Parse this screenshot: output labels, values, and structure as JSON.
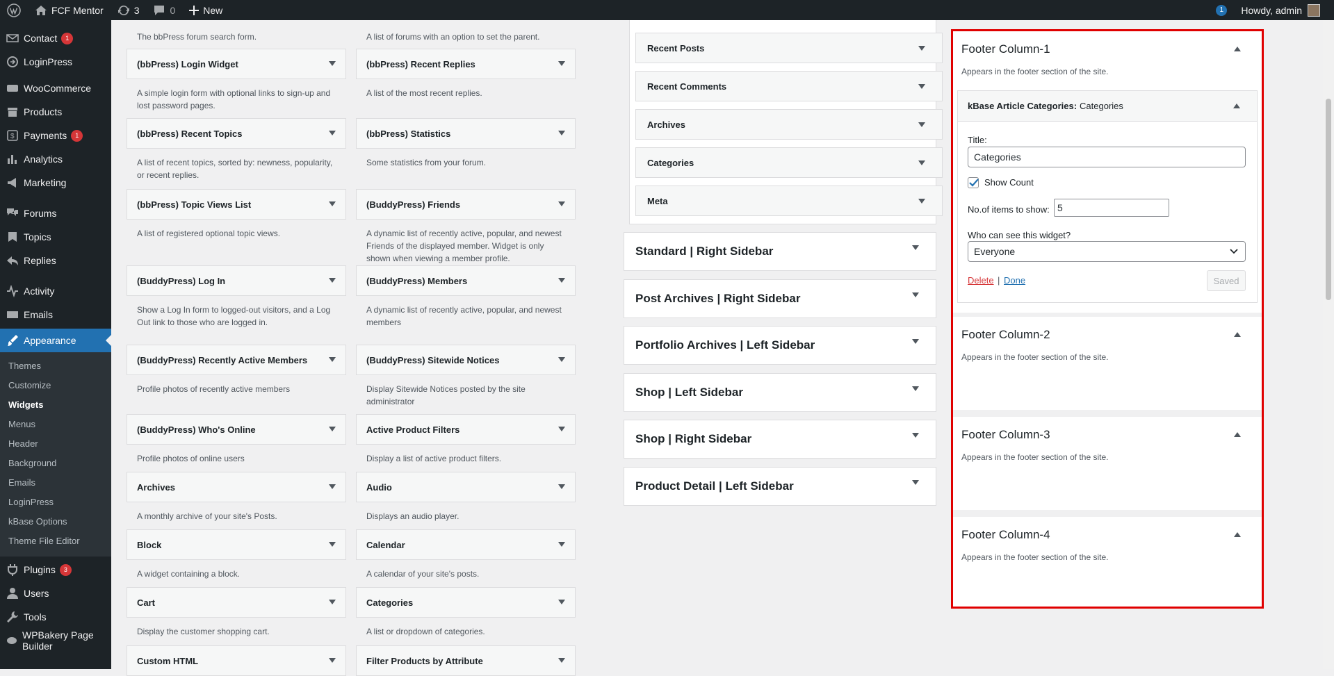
{
  "adminbar": {
    "site_name": "FCF Mentor",
    "updates_count": "3",
    "comments_count": "0",
    "new_label": "New",
    "notif_count": "1",
    "howdy": "Howdy, admin"
  },
  "sidebar": {
    "items_top": [
      {
        "label": "Contact",
        "count": "1",
        "icon": "mail-icon"
      },
      {
        "label": "LoginPress",
        "count": "",
        "icon": "loginpress-icon"
      }
    ],
    "items_mid": [
      {
        "label": "WooCommerce",
        "count": "",
        "icon": "woo-icon"
      },
      {
        "label": "Products",
        "count": "",
        "icon": "archive-icon"
      },
      {
        "label": "Payments",
        "count": "1",
        "icon": "payments-icon"
      },
      {
        "label": "Analytics",
        "count": "",
        "icon": "chart-icon"
      },
      {
        "label": "Marketing",
        "count": "",
        "icon": "megaphone-icon"
      }
    ],
    "items_forum": [
      {
        "label": "Forums",
        "count": "",
        "icon": "forums-icon"
      },
      {
        "label": "Topics",
        "count": "",
        "icon": "topics-icon"
      },
      {
        "label": "Replies",
        "count": "",
        "icon": "replies-icon"
      }
    ],
    "items_bp": [
      {
        "label": "Activity",
        "count": "",
        "icon": "activity-icon"
      },
      {
        "label": "Emails",
        "count": "",
        "icon": "email-icon"
      }
    ],
    "current": "Appearance",
    "submenu": [
      "Themes",
      "Customize",
      "Widgets",
      "Menus",
      "Header",
      "Background",
      "Emails",
      "LoginPress",
      "kBase Options",
      "Theme File Editor"
    ],
    "items_bottom": [
      {
        "label": "Plugins",
        "count": "3",
        "icon": "plugins-icon"
      },
      {
        "label": "Users",
        "count": "",
        "icon": "users-icon"
      },
      {
        "label": "Tools",
        "count": "",
        "icon": "tools-icon"
      },
      {
        "label": "WPBakery Page Builder",
        "count": "",
        "icon": "wpbakery-icon"
      }
    ]
  },
  "available_widgets": {
    "top_desc_left": "The bbPress forum search form.",
    "top_desc_right": "A list of forums with an option to set the parent.",
    "left": [
      {
        "title": "(bbPress) Login Widget",
        "desc": "A simple login form with optional links to sign-up and lost password pages."
      },
      {
        "title": "(bbPress) Recent Topics",
        "desc": "A list of recent topics, sorted by: newness, popularity, or recent replies."
      },
      {
        "title": "(bbPress) Topic Views List",
        "desc": "A list of registered optional topic views."
      },
      {
        "title": "(BuddyPress) Log In",
        "desc": "Show a Log In form to logged-out visitors, and a Log Out link to those who are logged in."
      },
      {
        "title": "(BuddyPress) Recently Active Members",
        "desc": "Profile photos of recently active members"
      },
      {
        "title": "(BuddyPress) Who's Online",
        "desc": "Profile photos of online users"
      },
      {
        "title": "Archives",
        "desc": "A monthly archive of your site's Posts."
      },
      {
        "title": "Block",
        "desc": "A widget containing a block."
      },
      {
        "title": "Cart",
        "desc": "Display the customer shopping cart."
      },
      {
        "title": "Custom HTML",
        "desc": ""
      }
    ],
    "right": [
      {
        "title": "(bbPress) Recent Replies",
        "desc": "A list of the most recent replies."
      },
      {
        "title": "(bbPress) Statistics",
        "desc": "Some statistics from your forum."
      },
      {
        "title": "(BuddyPress) Friends",
        "desc": "A dynamic list of recently active, popular, and newest Friends of the displayed member. Widget is only shown when viewing a member profile."
      },
      {
        "title": "(BuddyPress) Members",
        "desc": "A dynamic list of recently active, popular, and newest members"
      },
      {
        "title": "(BuddyPress) Sitewide Notices",
        "desc": "Display Sitewide Notices posted by the site administrator"
      },
      {
        "title": "Active Product Filters",
        "desc": "Display a list of active product filters."
      },
      {
        "title": "Audio",
        "desc": "Displays an audio player."
      },
      {
        "title": "Calendar",
        "desc": "A calendar of your site's posts."
      },
      {
        "title": "Categories",
        "desc": "A list or dropdown of categories."
      },
      {
        "title": "Filter Products by Attribute",
        "desc": ""
      }
    ]
  },
  "widget_areas": {
    "inner_widgets": [
      "Recent Posts",
      "Recent Comments",
      "Archives",
      "Categories",
      "Meta"
    ],
    "sidebars": [
      "Standard | Right Sidebar",
      "Post Archives | Right Sidebar",
      "Portfolio Archives | Left Sidebar",
      "Shop | Left Sidebar",
      "Shop | Right Sidebar",
      "Product Detail | Left Sidebar"
    ]
  },
  "footer": {
    "desc": "Appears in the footer section of the site.",
    "col1": "Footer Column-1",
    "col2": "Footer Column-2",
    "col3": "Footer Column-3",
    "col4": "Footer Column-4",
    "widget": {
      "name": "kBase Article Categories:",
      "sub": "Categories",
      "title_label": "Title:",
      "title_value": "Categories",
      "show_count_label": "Show Count",
      "items_label": "No.of items to show:",
      "items_value": "5",
      "visibility_label": "Who can see this widget?",
      "visibility_value": "Everyone",
      "delete": "Delete",
      "sep": "|",
      "done": "Done",
      "saved": "Saved"
    }
  },
  "colors": {
    "accent": "#2271b1",
    "highlight": "#e00000",
    "badge": "#d63638"
  }
}
